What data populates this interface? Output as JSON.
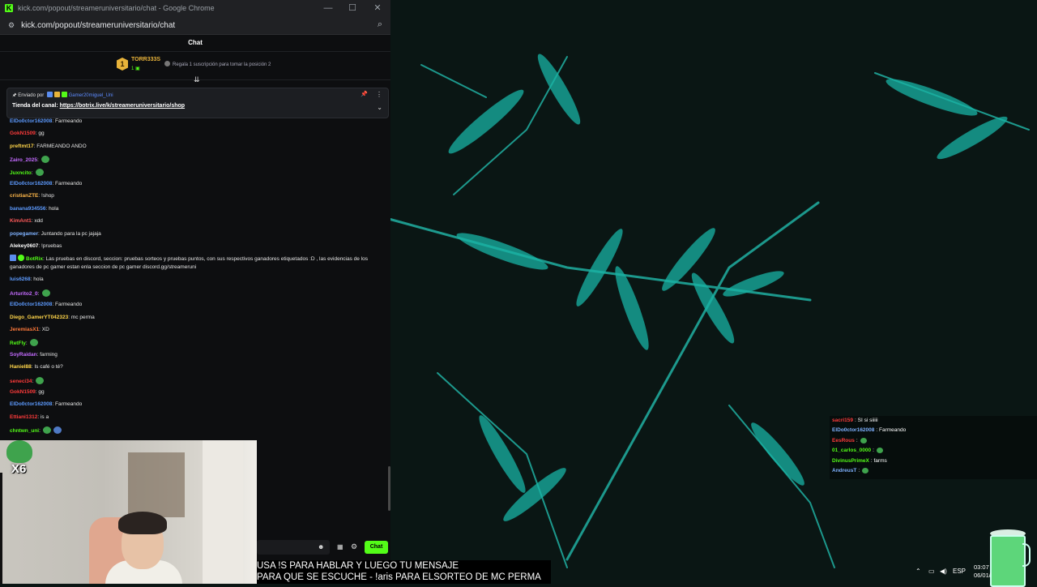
{
  "window": {
    "title": "kick.com/popout/streameruniversitario/chat - Google Chrome",
    "url": "kick.com/popout/streameruniversitario/chat"
  },
  "chat_header": "Chat",
  "leaderboard": {
    "rank": "1",
    "top_user": "TORR333S",
    "top_count": "1",
    "gift_hint": "Regala 1 suscripción para tomar la posición 2"
  },
  "pinned": {
    "sent_by_label": "Enviado por",
    "sender": "Gamer20miguel_Uni",
    "store_label": "Tienda del canal:",
    "store_link": "https://botrix.live/k/streameruniversitario/shop"
  },
  "messages": [
    {
      "user": "ElDo0ctor162008",
      "color": "#5d9bff",
      "text": ": Farmeando",
      "emotes": 0
    },
    {
      "user": "GokN1509",
      "color": "#ff3b3b",
      "text": ": gg",
      "emotes": 0
    },
    {
      "user": "preftmt17",
      "color": "#ffd54a",
      "text": ": FARMEANDO ANDO",
      "emotes": 0
    },
    {
      "user": "Zairo_2025",
      "color": "#c46bff",
      "text": ":",
      "emotes": 1
    },
    {
      "user": "Juxncito",
      "color": "#53fc18",
      "text": ":",
      "emotes": 1
    },
    {
      "user": "ElDo0ctor162008",
      "color": "#5d9bff",
      "text": ": Farmeando",
      "emotes": 0
    },
    {
      "user": "cristianZTE",
      "color": "#ffb84a",
      "text": ": !shop",
      "emotes": 0
    },
    {
      "user": "banana934556",
      "color": "#5d9bff",
      "text": ": hola",
      "emotes": 0
    },
    {
      "user": "KimAnt1",
      "color": "#ff5a5a",
      "text": ": xdd",
      "emotes": 0
    },
    {
      "user": "popegamer",
      "color": "#7fb2ff",
      "text": ": Juntando para la pc jajaja",
      "emotes": 0
    },
    {
      "user": "Alekey0607",
      "color": "#ffffff",
      "text": ": !pruebas",
      "emotes": 0
    }
  ],
  "botrix": {
    "user": "BotRix",
    "text": ": Las pruebas en discord, seccion: pruebas sorteos y pruebas puntos, con sus respectivos ganadores etiquetados :D , las evidencias de los ganadores de pc gamer estan enla seccion de pc gamer discord.gg/streameruni"
  },
  "messages2": [
    {
      "user": "luis6268",
      "color": "#5d9bff",
      "text": ": hola",
      "emotes": 0
    },
    {
      "user": "Arturito2_0",
      "color": "#c46bff",
      "text": ":",
      "emotes": 1
    },
    {
      "user": "ElDo0ctor162008",
      "color": "#5d9bff",
      "text": ": Farmeando",
      "emotes": 0
    },
    {
      "user": "Diego_GamerYT042323",
      "color": "#ffd54a",
      "text": ": mc perma",
      "emotes": 0
    },
    {
      "user": "JeremiasX1",
      "color": "#ff7a3b",
      "text": ": XD",
      "emotes": 0
    },
    {
      "user": "RetFly",
      "color": "#53fc18",
      "text": ":",
      "emotes": 1
    },
    {
      "user": "SoyRaidan",
      "color": "#c46bff",
      "text": ": farming",
      "emotes": 0
    },
    {
      "user": "Haniel88",
      "color": "#ffd54a",
      "text": ": Is café o té?",
      "emotes": 0
    },
    {
      "user": "seneci34",
      "color": "#ff3b3b",
      "text": ":",
      "emotes": 1
    },
    {
      "user": "GokN1509",
      "color": "#ff3b3b",
      "text": ": gg",
      "emotes": 0
    },
    {
      "user": "ElDo0ctor162008",
      "color": "#5d9bff",
      "text": ": Farmeando",
      "emotes": 0
    },
    {
      "user": "Ettiani1312",
      "color": "#ff3b3b",
      "text": ": is a",
      "emotes": 0
    },
    {
      "user": "chntwn_uni",
      "color": "#53fc18",
      "text": ":",
      "emotes": 2
    }
  ],
  "multiplier": "X6",
  "input": {
    "send_label": "Chat"
  },
  "subtitles": {
    "line1": "USA !S PARA HABLAR Y LUEGO TU MENSAJE",
    "line2": "PARA QUE SE ESCUCHE - !aris PARA ELSORTEO DE MC PERMA"
  },
  "overlay_chat": [
    {
      "user": "sacri159",
      "color": "#ff3b3b",
      "text": ": SI si siiiii"
    },
    {
      "user": "ElDo0ctor162008",
      "color": "#7fb2ff",
      "text": ": Farmeando"
    },
    {
      "user": "EesRous",
      "color": "#ff3b3b",
      "text": ":",
      "emote": true
    },
    {
      "user": "01_carlos_0000",
      "color": "#53fc18",
      "text": ":",
      "emote": true
    },
    {
      "user": "DivinusPrimeX",
      "color": "#53fc18",
      "text": ": farms"
    },
    {
      "user": "AndreusT",
      "color": "#7fb2ff",
      "text": ":",
      "emote": true
    }
  ],
  "tray": {
    "lang": "ESP",
    "time": "03:07",
    "date": "06/01/"
  }
}
